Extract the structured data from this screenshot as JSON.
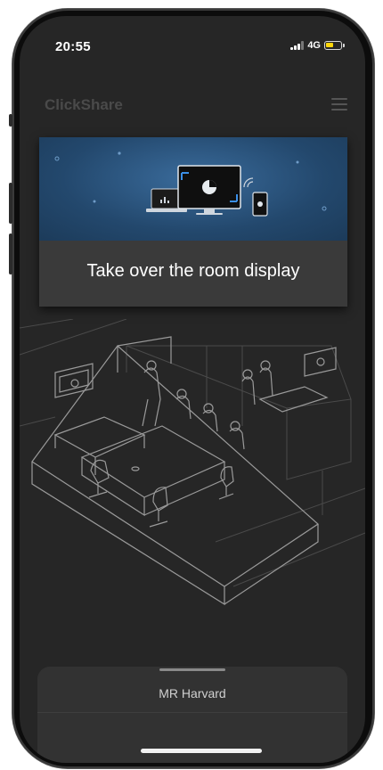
{
  "status_bar": {
    "time": "20:55",
    "network": "4G",
    "battery_level": 0.55,
    "battery_color": "#ffd60a"
  },
  "header": {
    "app_name": "ClickShare",
    "menu_icon": "hamburger-menu-icon"
  },
  "card": {
    "title": "Take over the room display",
    "hero_icons": [
      "laptop-icon",
      "monitor-icon",
      "phone-icon"
    ],
    "hero_color": "#2a5580"
  },
  "bottom_sheet": {
    "room_name": "MR Harvard"
  },
  "colors": {
    "background": "#262626",
    "card": "#3a3a3a",
    "text": "#ffffff"
  }
}
